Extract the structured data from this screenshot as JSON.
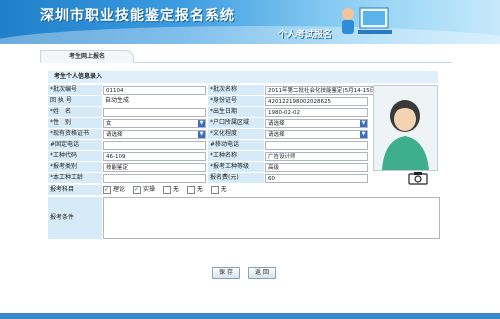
{
  "header": {
    "title": "深圳市职业技能鉴定报名系统",
    "subtitle": "个人考试报名"
  },
  "tabs": [
    {
      "label": "考生网上报名"
    }
  ],
  "form": {
    "section_title": "考生个人信息录入",
    "rows": [
      {
        "l1": "*批次编号",
        "v1": "01104",
        "l2": "*批次名称",
        "v2": "2011年第二批社会化技能鉴定(5月14-15日考试)"
      },
      {
        "l1": "回 执 号",
        "v1": "自动生成",
        "l2": "*身份证号",
        "v2": "420122198002028625"
      },
      {
        "l1": "*姓　名",
        "v1": "",
        "l2": "*出生日期",
        "v2": "1980-02-02"
      },
      {
        "l1": "*性　别",
        "v1": "女",
        "l2": "*户口所属区域",
        "v2": "请选择"
      },
      {
        "l1": "*现有资格证书",
        "v1": "请选择",
        "l2": "*文化程度",
        "v2": "请选择"
      },
      {
        "l1": "#固定电话",
        "v1": "",
        "l2": "#移动电话",
        "v2": ""
      },
      {
        "l1": "*工种代码",
        "v1": "46-109",
        "l2": "*工种名称",
        "v2": "广告设计师"
      },
      {
        "l1": "*报考类别",
        "v1": "技能鉴定",
        "l2": "*报考工种等级",
        "v2": "高级"
      },
      {
        "l1": "*本工种工龄",
        "v1": "",
        "l2": "报名费(元)",
        "v2": "60"
      }
    ],
    "subjects_label": "报考科目",
    "subjects": [
      {
        "label": "理论",
        "checked": true
      },
      {
        "label": "实操",
        "checked": true
      },
      {
        "label": "无",
        "checked": false
      },
      {
        "label": "无",
        "checked": false
      },
      {
        "label": "无",
        "checked": false
      }
    ],
    "conditions_label": "报考条件"
  },
  "buttons": {
    "save": "保 存",
    "back": "返 回"
  },
  "colors": {
    "accent": "#3a88cc",
    "label_bg": "#d6ebf7"
  },
  "icons": {
    "photo": "person-placeholder-icon",
    "camera": "camera-icon"
  }
}
